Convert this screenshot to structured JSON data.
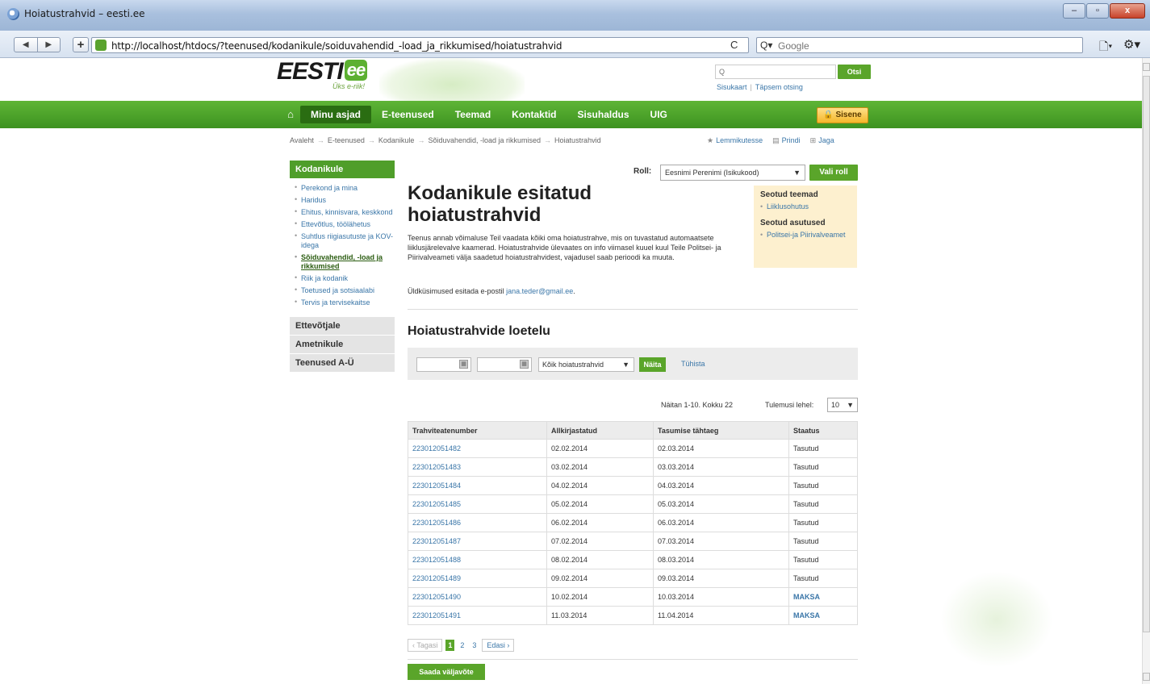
{
  "window": {
    "title": "Hoiatustrahvid – eesti.ee",
    "buttons": [
      "–",
      "▫",
      "x"
    ]
  },
  "browser": {
    "back": "◀",
    "forward": "▶",
    "new_tab": "+",
    "url": "http://localhost/htdocs/?teenused/kodanikule/soiduvahendid_-load_ja_rikkumised/hoiatustrahvid",
    "reload": "C",
    "search_icon_text": "Q▾",
    "search_placeholder": "Google",
    "page_menu": "🗋▾",
    "tools_menu": "⚙▾"
  },
  "header": {
    "logo_text": "EESTI",
    "logo_badge": "ee",
    "slogan": "Üks e-riik!",
    "search_placeholder": "Q",
    "search_button": "Otsi",
    "links": [
      "Sisukaart",
      "Täpsem otsing"
    ]
  },
  "nav": {
    "home_icon": "⌂",
    "tabs": [
      "Minu asjad",
      "E-teenused",
      "Teemad",
      "Kontaktid",
      "Sisuhaldus",
      "UIG"
    ],
    "login": "🔒 Sisene"
  },
  "breadcrumb": [
    "Avaleht",
    "E-teenused",
    "Kodanikule",
    "Sõiduvahendid, -load ja rikkumised",
    "Hoiatustrahvid"
  ],
  "utils": {
    "favorites": "Lemmikutesse",
    "print": "Prindi",
    "share": "Jaga"
  },
  "sidebar": {
    "heading": "Kodanikule",
    "items": [
      "Perekond ja mina",
      "Haridus",
      "Ehitus, kinnisvara, keskkond",
      "Ettevõtlus, töölähetus",
      "Suhtlus riigiasutuste ja KOV-idega",
      "Sõiduvahendid, -load ja rikkumised",
      "Riik ja kodanik",
      "Toetused ja sotsiaalabi",
      "Tervis ja tervisekaitse"
    ],
    "sections": [
      "Ettevõtjale",
      "Ametnikule",
      "Teenused A-Ü"
    ]
  },
  "main": {
    "role_label": "Roll:",
    "role_value": "Eesnimi Perenimi (Isikukood)",
    "role_button": "Vali roll",
    "title": "Kodanikule esitatud hoiatustrahvid",
    "intro": "Teenus annab võimaluse Teil vaadata kõiki oma hoiatustrahve, mis on tuvastatud automaatsete liiklusjärelevalve kaamerad. Hoiatustrahvide ülevaates on info viimasel kuuel kuul Teile Politsei- ja Piirivalveameti välja saadetud hoiatustrahvidest, vajadusel saab perioodi ka muuta.",
    "contact_prefix": "Üldküsimused esitada e-postil",
    "contact_email": "jana.teder@gmail.ee",
    "contact_suffix": ".",
    "related": {
      "topics_title": "Seotud teemad",
      "topics": [
        "Liiklusohutus"
      ],
      "agencies_title": "Seotud asutused",
      "agencies": [
        "Politsei-ja Piirivalveamet"
      ]
    },
    "list_title": "Hoiatustrahvide loetelu",
    "filter": {
      "calendar_icon": "▦",
      "type": "Kõik hoiatustrahvid",
      "show": "Näita",
      "cancel": "Tühista"
    },
    "results_info": "Näitan 1-10. Kokku 22",
    "per_page_label": "Tulemusi lehel:",
    "per_page_value": "10",
    "table": {
      "headers": [
        "Trahviteatenumber",
        "Allkirjastatud",
        "Tasumise tähtaeg",
        "Staatus"
      ],
      "rows": [
        [
          "223012051482",
          "02.02.2014",
          "02.03.2014",
          "Tasutud"
        ],
        [
          "223012051483",
          "03.02.2014",
          "03.03.2014",
          "Tasutud"
        ],
        [
          "223012051484",
          "04.02.2014",
          "04.03.2014",
          "Tasutud"
        ],
        [
          "223012051485",
          "05.02.2014",
          "05.03.2014",
          "Tasutud"
        ],
        [
          "223012051486",
          "06.02.2014",
          "06.03.2014",
          "Tasutud"
        ],
        [
          "223012051487",
          "07.02.2014",
          "07.03.2014",
          "Tasutud"
        ],
        [
          "223012051488",
          "08.02.2014",
          "08.03.2014",
          "Tasutud"
        ],
        [
          "223012051489",
          "09.02.2014",
          "09.03.2014",
          "Tasutud"
        ],
        [
          "223012051490",
          "10.02.2014",
          "10.03.2014",
          "MAKSA"
        ],
        [
          "223012051491",
          "11.03.2014",
          "11.04.2014",
          "MAKSA"
        ]
      ]
    },
    "pager": {
      "prev": "‹ Tagasi",
      "pages": [
        "1",
        "2",
        "3"
      ],
      "next": "Edasi ›"
    },
    "send_request": "Saada väljavõte"
  },
  "colors": {
    "brand_green": "#4f9e2a",
    "link_blue": "#3a76a8",
    "related_bg": "#fdf0cf"
  }
}
